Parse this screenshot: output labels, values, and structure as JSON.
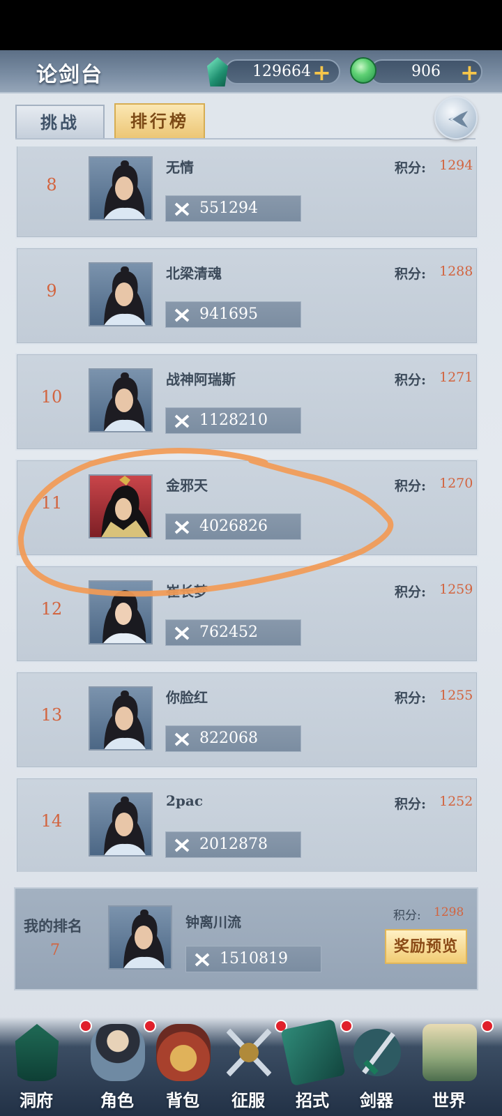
{
  "header": {
    "title": "论剑台",
    "currency_gem": "129664",
    "currency_jade": "906",
    "plus": "+"
  },
  "tabs": {
    "challenge": "挑战",
    "ranking": "排行榜"
  },
  "rankings": [
    {
      "rank": "8",
      "name": "无情",
      "power": "551294",
      "score_label": "积分:",
      "score": "1294"
    },
    {
      "rank": "9",
      "name": "北梁清魂",
      "power": "941695",
      "score_label": "积分:",
      "score": "1288"
    },
    {
      "rank": "10",
      "name": "战神阿瑞斯",
      "power": "1128210",
      "score_label": "积分:",
      "score": "1271"
    },
    {
      "rank": "11",
      "name": "金邪天",
      "power": "4026826",
      "score_label": "积分:",
      "score": "1270"
    },
    {
      "rank": "12",
      "name": "崔长梦",
      "power": "762452",
      "score_label": "积分:",
      "score": "1259"
    },
    {
      "rank": "13",
      "name": "你脸红",
      "power": "822068",
      "score_label": "积分:",
      "score": "1255"
    },
    {
      "rank": "14",
      "name": "2pac",
      "power": "2012878",
      "score_label": "积分:",
      "score": "1252"
    }
  ],
  "my_rank": {
    "label": "我的排名",
    "rank": "7",
    "name": "钟离川流",
    "power": "1510819",
    "score_label": "积分:",
    "score": "1298",
    "reward_button": "奖励预览"
  },
  "nav": [
    {
      "label": "洞府",
      "icon": "cave-dwelling-icon"
    },
    {
      "label": "角色",
      "icon": "character-icon"
    },
    {
      "label": "背包",
      "icon": "bag-icon"
    },
    {
      "label": "征服",
      "icon": "crossed-swords-icon"
    },
    {
      "label": "招式",
      "icon": "skill-book-icon"
    },
    {
      "label": "剑器",
      "icon": "sword-icon"
    },
    {
      "label": "世界",
      "icon": "world-scroll-icon"
    }
  ],
  "colors": {
    "accent_orange": "#d2643f",
    "annotation_orange": "#f29a55",
    "badge_red": "#e0202b",
    "tab_gold": "#ecc675"
  }
}
